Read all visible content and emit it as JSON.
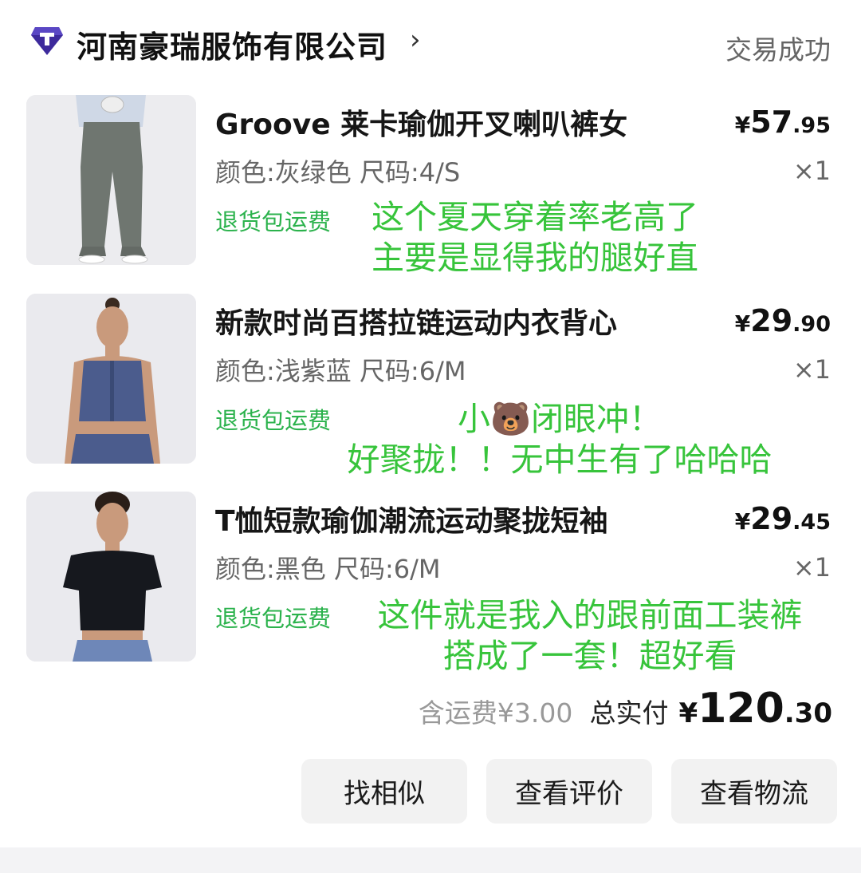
{
  "shop": {
    "name": "河南豪瑞服饰有限公司",
    "arrow": "›",
    "status": "交易成功",
    "logo_icon": "t-gem-logo-icon"
  },
  "items": [
    {
      "title": "Groove 莱卡瑜伽开叉喇叭裤女",
      "price_cur": "¥",
      "price_int": "57",
      "price_dec": ".95",
      "spec": "颜色:灰绿色 尺码:4/S",
      "qty": "×1",
      "tag": "退货包运费",
      "note_line1": "这个夏天穿着率老高了",
      "note_line2": "主要是显得我的腿好直",
      "image": "flared-yoga-pants-photo"
    },
    {
      "title": "新款时尚百搭拉链运动内衣背心",
      "price_cur": "¥",
      "price_int": "29",
      "price_dec": ".90",
      "spec": "颜色:浅紫蓝 尺码:6/M",
      "qty": "×1",
      "tag": "退货包运费",
      "note_line1": "小🐻闭眼冲！",
      "note_line2": "好聚拢！！无中生有了哈哈哈",
      "image": "zip-sports-bra-photo"
    },
    {
      "title": "T恤短款瑜伽潮流运动聚拢短袖",
      "price_cur": "¥",
      "price_int": "29",
      "price_dec": ".45",
      "spec": "颜色:黑色 尺码:6/M",
      "qty": "×1",
      "tag": "退货包运费",
      "note_line1": "这件就是我入的跟前面工装裤",
      "note_line2": "搭成了一套！超好看",
      "image": "crop-tshirt-photo"
    }
  ],
  "summary": {
    "shipping": "含运费¥3.00",
    "total_label": "总实付",
    "total_cur": "¥",
    "total_int": "120",
    "total_dec": ".30"
  },
  "buttons": {
    "similar": "找相似",
    "reviews": "查看评价",
    "logistics": "查看物流"
  },
  "colors": {
    "accent_green": "#37c43b",
    "tag_green": "#2bb24c",
    "logo_purple": "#3d2a9c"
  }
}
